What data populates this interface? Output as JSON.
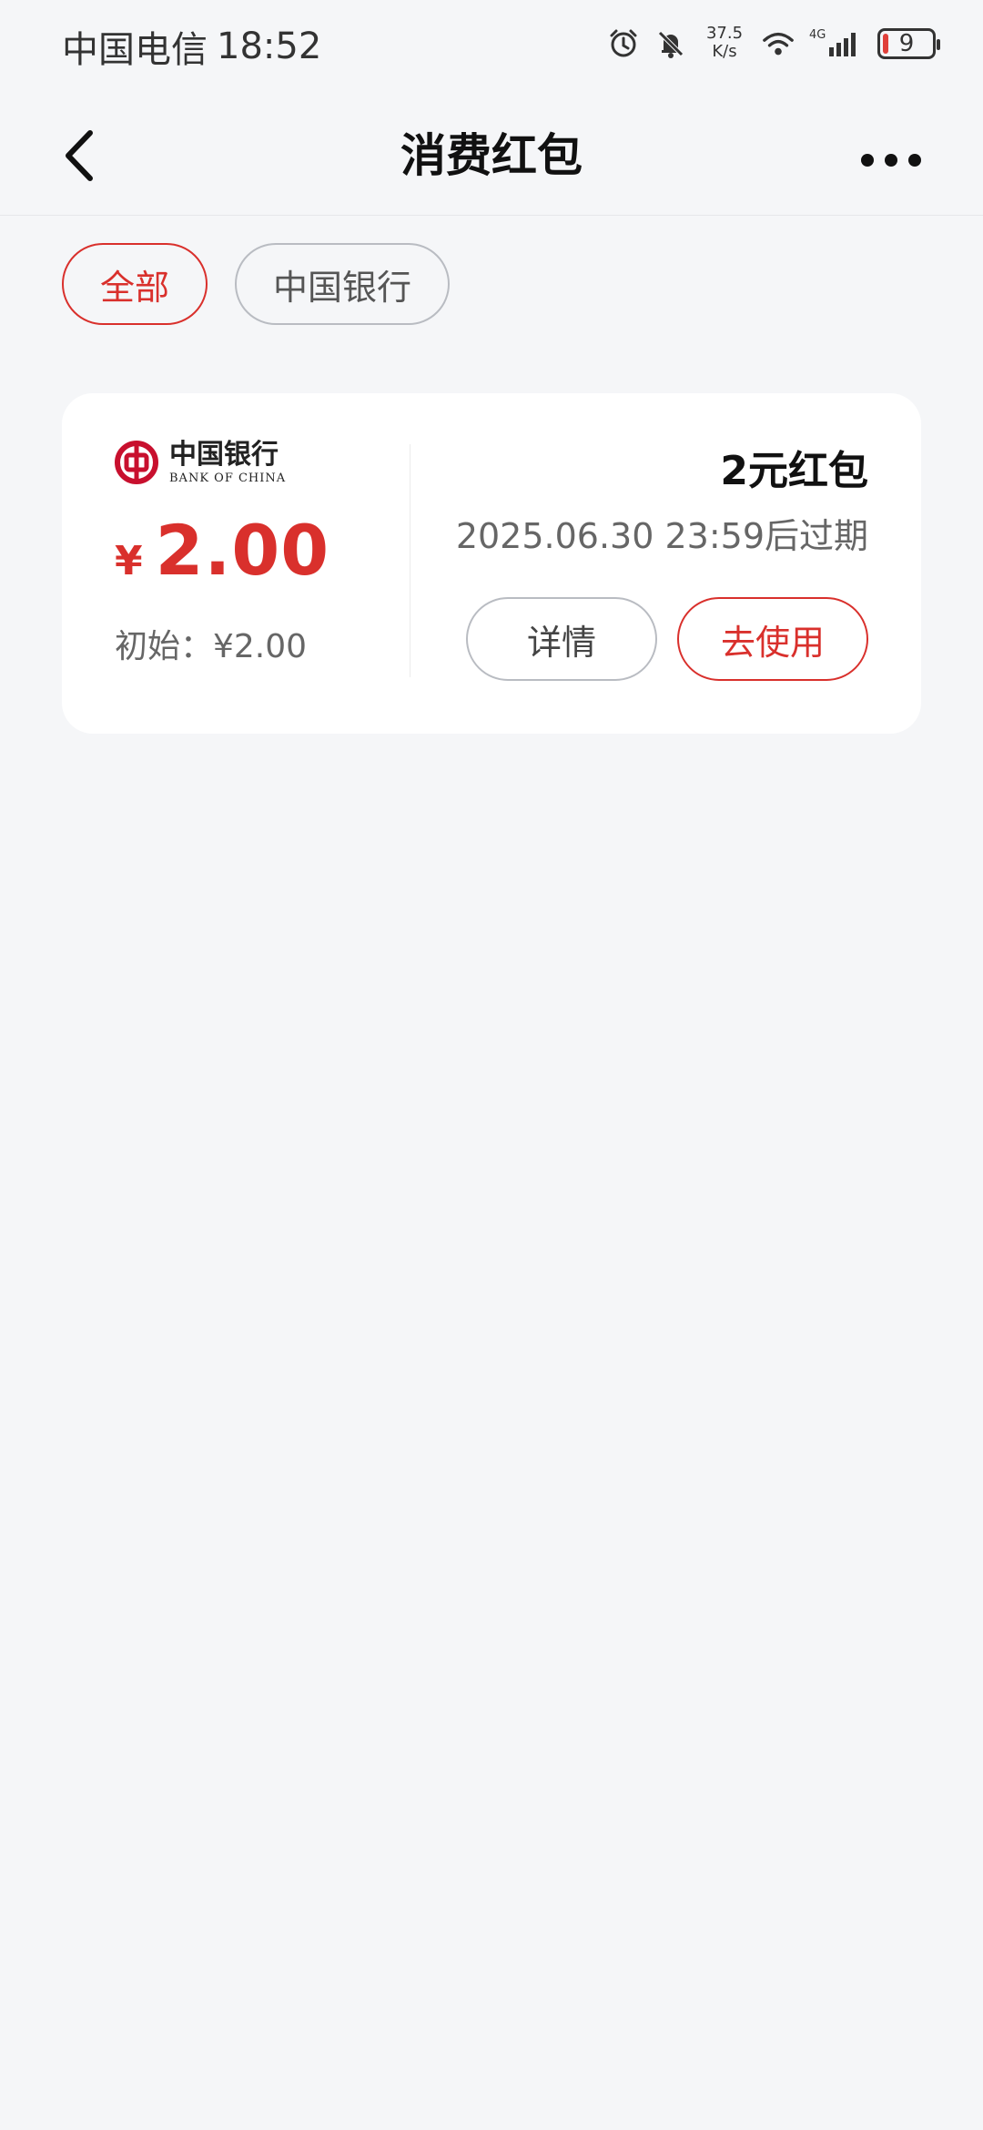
{
  "status_bar": {
    "carrier": "中国电信",
    "time": "18:52",
    "net_speed_value": "37.5",
    "net_speed_unit": "K/s",
    "network": "4G",
    "battery": "9",
    "icons": [
      "alarm-icon",
      "mute-bell-icon",
      "wifi-icon",
      "signal-icon",
      "battery-icon"
    ]
  },
  "header": {
    "title": "消费红包"
  },
  "filters": {
    "items": [
      {
        "label": "全部",
        "active": true
      },
      {
        "label": "中国银行",
        "active": false
      }
    ]
  },
  "coupon": {
    "bank_name_cn": "中国银行",
    "bank_name_en": "BANK OF CHINA",
    "currency": "¥",
    "amount": "2.00",
    "initial": "初始：¥2.00",
    "name": "2元红包",
    "expiry": "2025.06.30 23:59后过期",
    "details_label": "详情",
    "use_label": "去使用"
  },
  "colors": {
    "accent": "#d9302c",
    "background": "#f5f6f8",
    "card": "#ffffff"
  }
}
